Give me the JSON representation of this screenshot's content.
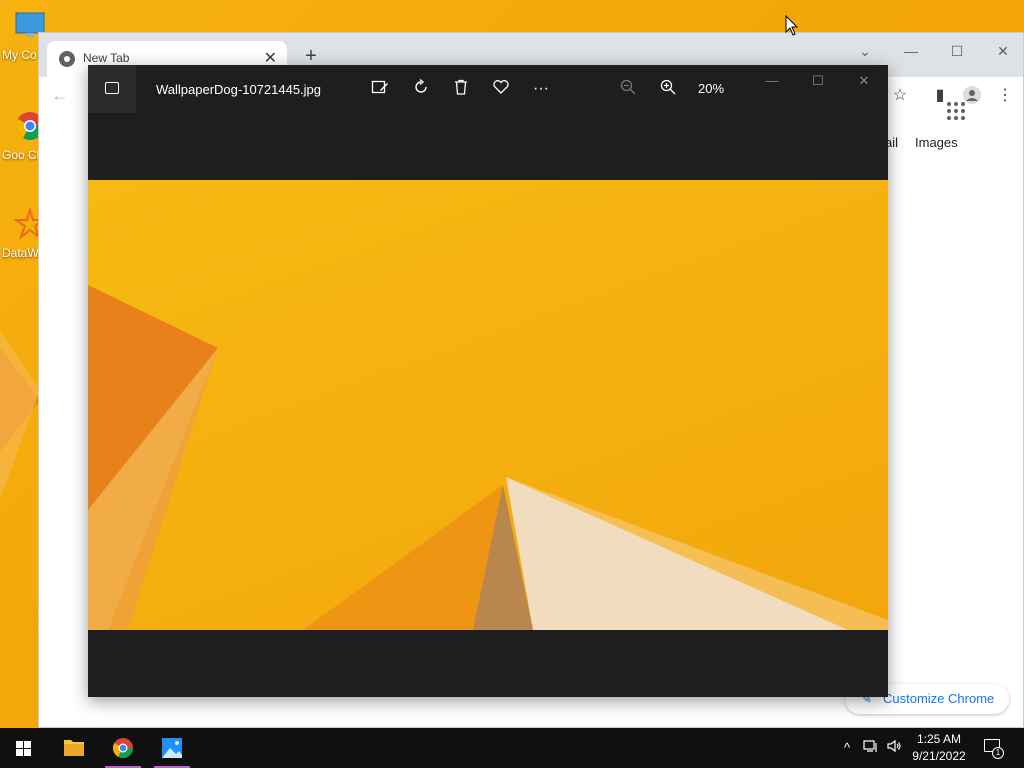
{
  "desktop": {
    "icons": [
      {
        "name": "my-computer",
        "label": "My Co"
      },
      {
        "name": "google-chrome",
        "label": "Goo Chr"
      },
      {
        "name": "datawrapper",
        "label": "DataW"
      }
    ]
  },
  "chrome": {
    "tab_title": "New Tab",
    "links": {
      "gmail": "ail",
      "images": "Images"
    },
    "customize_label": "Customize Chrome"
  },
  "photos": {
    "filename": "WallpaperDog-10721445.jpg",
    "zoom": "20%"
  },
  "taskbar": {
    "time": "1:25 AM",
    "date": "9/21/2022",
    "notification_count": "1"
  },
  "colors": {
    "photos_bg": "#1e1e1e",
    "wallpaper_yellow": "#f4ae0e",
    "wallpaper_orange": "#ea7d18",
    "taskbar_bg": "#101010",
    "chrome_accent": "#1a73e8"
  }
}
